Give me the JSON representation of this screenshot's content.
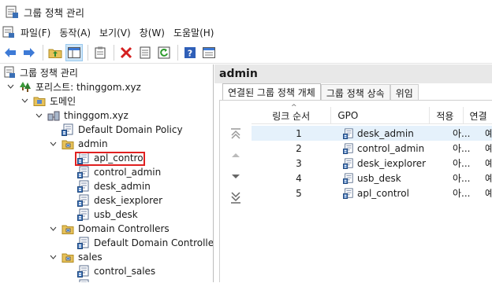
{
  "window": {
    "title": "그룹 정책 관리"
  },
  "menu": {
    "items": [
      "파일(F)",
      "동작(A)",
      "보기(V)",
      "창(W)",
      "도움말(H)"
    ]
  },
  "toolbar": {
    "buttons": [
      "back-icon",
      "forward-icon",
      "up-folder-icon",
      "show-hide-tree-icon",
      "clipboard-icon",
      "delete-icon",
      "properties-icon",
      "refresh-icon",
      "help-icon",
      "console-icon"
    ]
  },
  "tree": {
    "root": "그룹 정책 관리",
    "forest": "포리스트: thinggom.xyz",
    "domains": "도메인",
    "domain": "thinggom.xyz",
    "default_policy": "Default Domain Policy",
    "admin_ou": "admin",
    "admin_children": [
      "apl_control",
      "control_admin",
      "desk_admin",
      "desk_iexplorer",
      "usb_desk"
    ],
    "dc_ou": "Domain Controllers",
    "dc_policy": "Default Domain Controllers",
    "sales_ou": "sales",
    "sales_children": [
      "control_sales"
    ]
  },
  "right": {
    "header": "admin",
    "tabs": [
      "연결된 그룹 정책 개체",
      "그룹 정책 상속",
      "위임"
    ],
    "columns": {
      "order": "링크 순서",
      "gpo": "GPO",
      "apply": "적용",
      "link": "연결"
    },
    "rows": [
      {
        "order": "1",
        "gpo": "desk_admin",
        "apply": "아...",
        "link": "예"
      },
      {
        "order": "2",
        "gpo": "control_admin",
        "apply": "아...",
        "link": "예"
      },
      {
        "order": "3",
        "gpo": "desk_iexplorer",
        "apply": "아...",
        "link": "예"
      },
      {
        "order": "4",
        "gpo": "usb_desk",
        "apply": "아...",
        "link": "예"
      },
      {
        "order": "5",
        "gpo": "apl_control",
        "apply": "아...",
        "link": "예"
      }
    ]
  },
  "colors": {
    "selection": "#e5f1fb",
    "highlight_border": "#e02020",
    "pane_header": "#e8e8e8"
  }
}
